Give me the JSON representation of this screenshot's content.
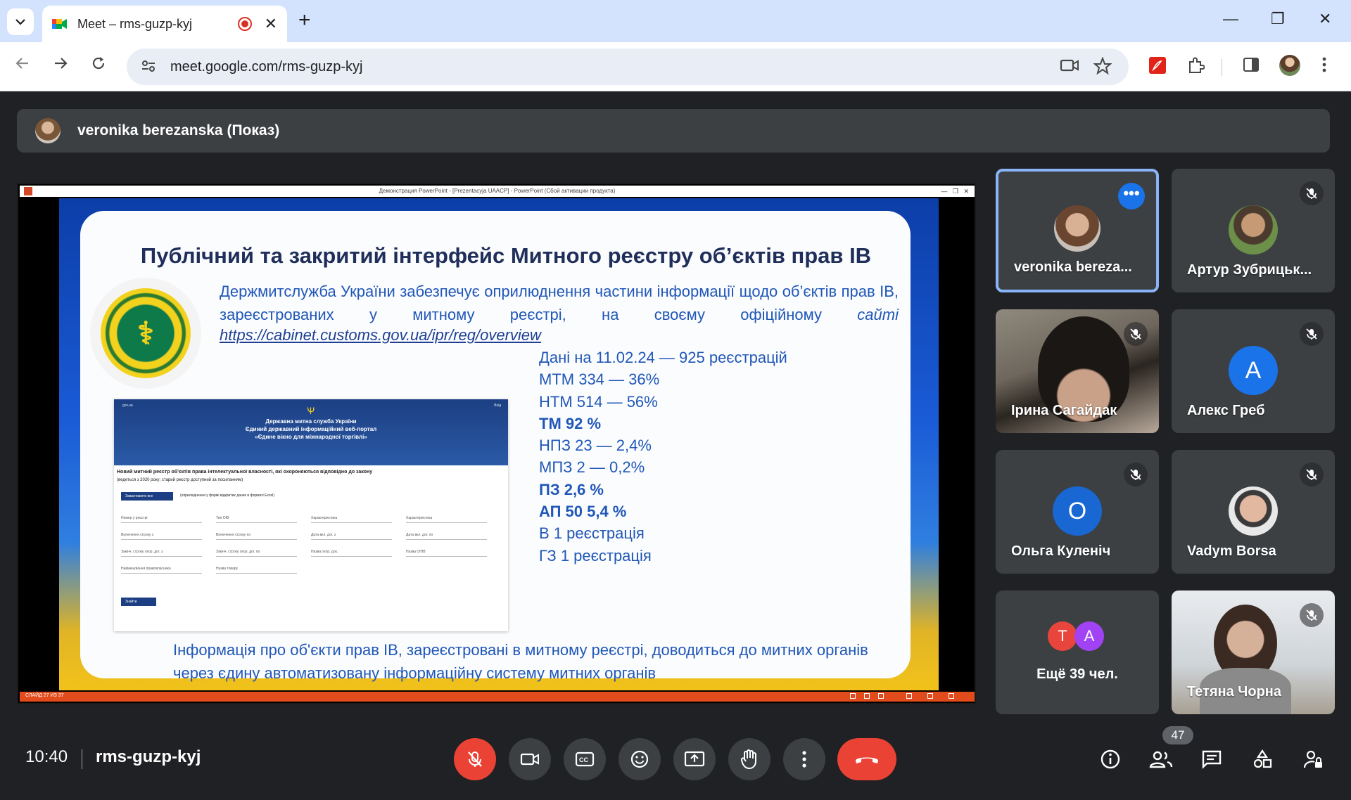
{
  "browser": {
    "tab_title": "Meet – rms-guzp-kyj",
    "new_tab": "+",
    "url": "meet.google.com/rms-guzp-kyj",
    "minimize": "—",
    "restore": "❐",
    "close": "✕"
  },
  "meet": {
    "presenter": "veronika berezanska (Показ)",
    "time": "10:40",
    "meeting_code": "rms-guzp-kyj",
    "participant_count": "47",
    "accent": "#8ab4f8",
    "end_call_color": "#ea4335"
  },
  "slide": {
    "window_title": "Демонстрация PowerPoint - [Prezentacyja UAACP] - PowerPoint (Сбой активации продукта)",
    "title": "Публічний та закритий інтерфейс Митного реєстру об’єктів прав ІВ",
    "paragraph": "Держмитслужба України забезпечує оприлюднення частини інформації щодо об’єктів прав ІВ, зареєстрованих у митному реєстрі, на своєму офіційному",
    "paragraph_end": "сайті",
    "link": "https://cabinet.customs.gov.ua/ipr/reg/overview",
    "stats": [
      "Дані на 11.02.24 — 925 реєстрацій",
      "МТМ 334 — 36%",
      "НТМ 514 — 56%",
      "ТМ 92 %",
      "НПЗ 23 — 2,4%",
      "МПЗ 2 — 0,2%",
      "ПЗ 2,6 %",
      "АП 50 5,4 %",
      "В 1 реєстрація",
      "ГЗ 1 реєстрація"
    ],
    "bottom_text": "Інформація про об'єкти прав ІВ, зареєстровані в митному   реєстрі, доводиться до митних органів через єдину автоматизовану інформаційну систему митних органів",
    "status": "СЛАЙД 27 ИЗ 37",
    "portal": {
      "agency": "Державна митна служба України",
      "title_1": "Єдиний державний інформаційний веб-портал",
      "title_2": "«Єдине вікно для міжнародної торгівлі»",
      "login": "Вхід",
      "gov": "gov.ua",
      "heading": "Новий митний реєстр об’єктів права інтелектуальної власності, які охороняються відповідно до закону",
      "subheading": "(ведеться з 2020 року; старий реєстр доступний за посиланням)",
      "download_button": "Завантажити все",
      "download_note": "(оприлюднення у формі відкритих даних в форматі Excel)",
      "search_button": "Знайти",
      "fields": [
        "Номер у реєстрі",
        "Тип ОІВ",
        "Характеристика",
        "Характеристика",
        "Включення строку з",
        "Включення строку по",
        "Дата вкл. дог. з",
        "Дата вкл. дог. по",
        "Закінч. строку охор. дог. з",
        "Закінч. строку охор. дог. по",
        "Назва охор. док.",
        "Назва ОПІВ",
        "Найменування правовласника",
        "Назва товару"
      ]
    }
  },
  "participants": [
    {
      "name": "veronika bereza...",
      "type": "photo",
      "active": true
    },
    {
      "name": "Артур Зубрицьк...",
      "type": "photo",
      "muted": true
    },
    {
      "name": "Ірина Сагайдак",
      "type": "video",
      "muted": true
    },
    {
      "name": "Алекс Греб",
      "type": "letter",
      "letter": "A",
      "color": "#1a73e8",
      "muted": true
    },
    {
      "name": "Ольга Куленіч",
      "type": "letter",
      "letter": "O",
      "color": "#1967d2",
      "muted": true
    },
    {
      "name": "Vadym Borsa",
      "type": "photo",
      "muted": true
    },
    {
      "name": "Ещё 39 чел.",
      "type": "more",
      "letters": [
        "T",
        "A"
      ],
      "colors": [
        "#e8453c",
        "#a142f4"
      ]
    },
    {
      "name": "Тетяна Чорна",
      "type": "video",
      "muted": true
    }
  ]
}
